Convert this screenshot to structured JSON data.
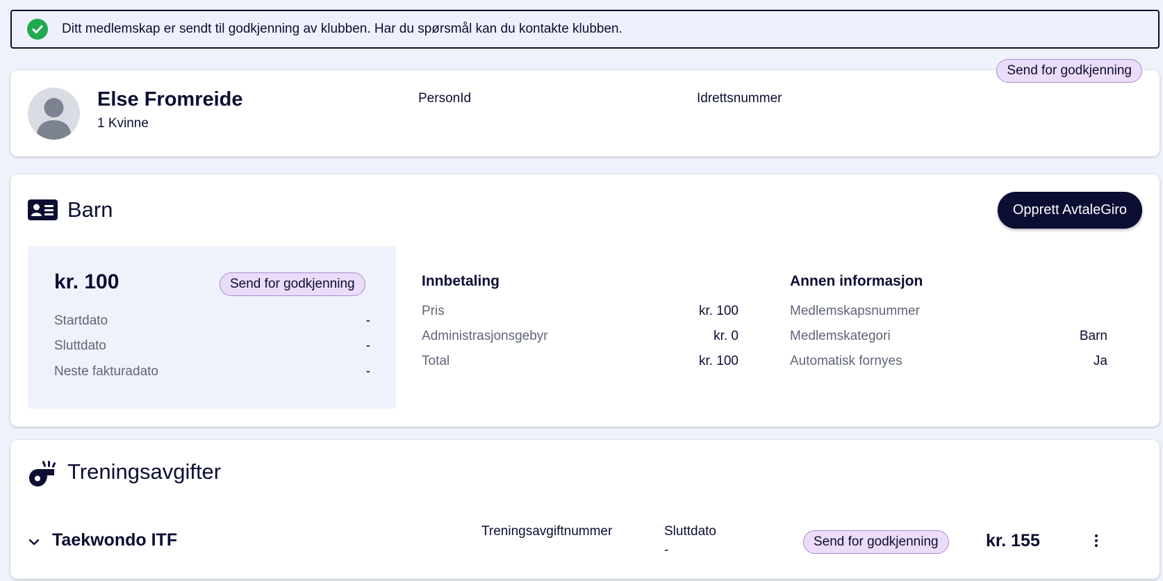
{
  "alert": {
    "message": "Ditt medlemskap er sendt til godkjenning av klubben. Har du spørsmål kan du kontakte klubben.",
    "icon": "check-circle-icon",
    "color": "#1faa4f"
  },
  "profile": {
    "status": "Send for godkjenning",
    "name": "Else Fromreide",
    "subtitle": "1 Kvinne",
    "person_id_label": "PersonId",
    "sports_number_label": "Idrettsnummer"
  },
  "membership": {
    "title": "Barn",
    "icon": "id-card-icon",
    "create_button": "Opprett AvtaleGiro",
    "summary": {
      "amount": "kr. 100",
      "status": "Send for godkjenning",
      "rows": [
        {
          "label": "Startdato",
          "value": "-"
        },
        {
          "label": "Sluttdato",
          "value": "-"
        },
        {
          "label": "Neste fakturadato",
          "value": "-"
        }
      ]
    },
    "payment": {
      "heading": "Innbetaling",
      "rows": [
        {
          "label": "Pris",
          "value": "kr. 100"
        },
        {
          "label": "Administrasjonsgebyr",
          "value": "kr. 0"
        },
        {
          "label": "Total",
          "value": "kr. 100"
        }
      ]
    },
    "other": {
      "heading": "Annen informasjon",
      "rows": [
        {
          "label": "Medlemskapsnummer",
          "value": ""
        },
        {
          "label": "Medlemskategori",
          "value": "Barn"
        },
        {
          "label": "Automatisk fornyes",
          "value": "Ja"
        }
      ]
    }
  },
  "training": {
    "title": "Treningsavgifter",
    "icon": "whistle-icon",
    "item": {
      "name": "Taekwondo ITF",
      "fee_number_label": "Treningsavgiftnummer",
      "end_date_label": "Sluttdato",
      "end_date_value": "-",
      "status": "Send for godkjenning",
      "price": "kr. 155"
    }
  },
  "colors": {
    "navy": "#0b0d33",
    "background": "#eff2fa",
    "pill_fill": "#ebdcf9",
    "pill_border": "#a98ad0",
    "success": "#1faa4f"
  }
}
